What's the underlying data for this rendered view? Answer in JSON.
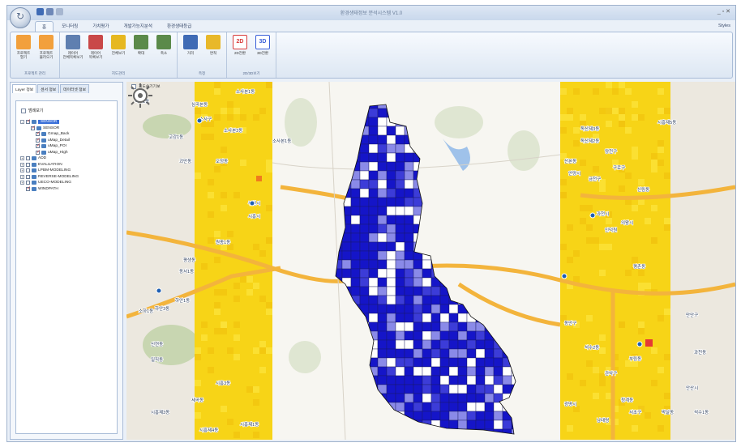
{
  "titlebar": {
    "title": "환경생태정보 분석시스템 V1.0",
    "window_controls": "_ ▫ ✕"
  },
  "ribbon_tabs": [
    "홈",
    "모니터링",
    "가치평가",
    "개발가능지분석",
    "환경생태등급"
  ],
  "style_label": "Styles",
  "ribbon_groups": [
    {
      "label": "프로젝트 관리",
      "buttons": [
        {
          "label": "프로젝트\n열기",
          "icon": "folder-open-icon",
          "color": "#f2a03c"
        },
        {
          "label": "프로젝트\n불러오기",
          "icon": "folder-icon",
          "color": "#f2a03c"
        }
      ]
    },
    {
      "label": "지도관리",
      "buttons": [
        {
          "label": "레이어\n전체목록보기",
          "icon": "layer-list-icon",
          "color": "#5f7fb0"
        },
        {
          "label": "레이어\n목록보기",
          "icon": "layer-icon",
          "color": "#c94848"
        },
        {
          "label": "전체보기",
          "icon": "full-extent-icon",
          "color": "#e6b820"
        },
        {
          "label": "확대",
          "icon": "zoom-in-icon",
          "color": "#5b8a4a"
        },
        {
          "label": "축소",
          "icon": "zoom-out-icon",
          "color": "#5b8a4a"
        }
      ]
    },
    {
      "label": "측정",
      "buttons": [
        {
          "label": "거리",
          "icon": "ruler-icon",
          "color": "#3f6bb5"
        },
        {
          "label": "면적",
          "icon": "area-icon",
          "color": "#e8b82a"
        }
      ]
    },
    {
      "label": "2D/3D보기",
      "buttons": [
        {
          "label": "2D전환",
          "icon": "2d-icon",
          "text": "2D",
          "color": "#d83a3a"
        },
        {
          "label": "3D전환",
          "icon": "3d-icon",
          "text": "3D",
          "color": "#3a5fd8"
        }
      ]
    }
  ],
  "left_panel": {
    "tabs": [
      "Layer 정보",
      "센서 정보",
      "데이터셋 정보"
    ],
    "select_all": "범례보기",
    "tree": [
      {
        "label": "SENSOR",
        "level": 1,
        "expander": "-",
        "checked": true,
        "selected": true
      },
      {
        "label": "SENSOR",
        "level": 2,
        "checked": true
      },
      {
        "label": "Gmap_Back",
        "level": 3,
        "checked": true
      },
      {
        "label": "uMap_Detail",
        "level": 3,
        "checked": true
      },
      {
        "label": "uMap_POI",
        "level": 3,
        "checked": true
      },
      {
        "label": "uMap_High",
        "level": 3,
        "checked": true
      },
      {
        "label": "ADD",
        "level": 1,
        "expander": "+",
        "checked": false
      },
      {
        "label": "EVALUATION",
        "level": 1,
        "expander": "+",
        "checked": false
      },
      {
        "label": "LPBM-MODELING",
        "level": 1,
        "expander": "+",
        "checked": false
      },
      {
        "label": "REVERSE-MODELING",
        "level": 1,
        "expander": "+",
        "checked": false
      },
      {
        "label": "UECO-MODELING",
        "level": 1,
        "expander": "+",
        "checked": false
      },
      {
        "label": "WINDPATH",
        "level": 1,
        "checked": true
      }
    ]
  },
  "map": {
    "toggle_label": "지도숨기기보",
    "labels": [
      "소사본1동",
      "심곡본동",
      "소사구",
      "소사본3동",
      "소사본1동",
      "역곡1동",
      "고강1동",
      "괴안동",
      "오정동",
      "부천시",
      "시흥시",
      "원종1동",
      "평생동",
      "동서1동",
      "하안1동",
      "소하1동",
      "하안3동",
      "신현동",
      "일직동",
      "시흥3동",
      "세곡동",
      "시흥제3동",
      "시흥제1동",
      "시흥제4동",
      "산본동",
      "독산제3동",
      "독산제2동",
      "금천구",
      "양천구",
      "구로구",
      "시흥제5동",
      "신림동",
      "안양시",
      "의왕시",
      "과천시",
      "인덕원",
      "만안구",
      "동안구",
      "석수2동",
      "부림동",
      "관악구",
      "청계동",
      "서초구",
      "과천동",
      "안산시",
      "광명시",
      "남태령",
      "박달동",
      "석수1동",
      "평촌동"
    ],
    "colors": {
      "heatmap_yellow": "#f7d417",
      "heatmap_orange": "#f2a31d",
      "grid_dark_blue": "#1515c8",
      "grid_light_blue": "#8a8ae8",
      "road_orange": "#f3b43c",
      "park_green": "#b9cf9c",
      "water_blue": "#9fc2ea"
    }
  }
}
